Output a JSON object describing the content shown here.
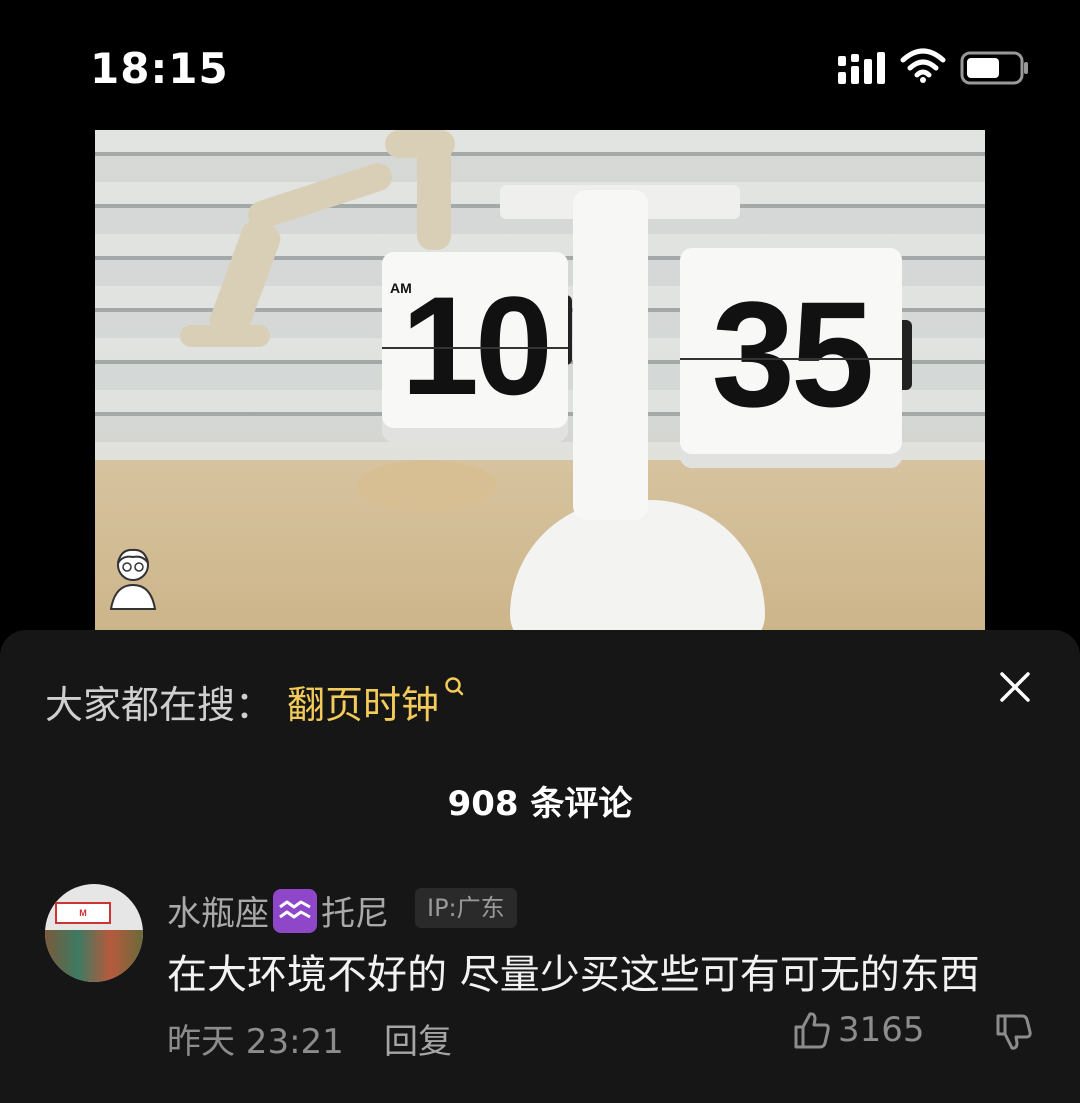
{
  "status_bar": {
    "time": "18:15"
  },
  "video": {
    "clock_ampm": "AM",
    "clock_hours": "10",
    "clock_minutes": "35"
  },
  "panel": {
    "search_prefix": "大家都在搜：",
    "search_term": "翻页时钟",
    "comments_count": "908 条评论"
  },
  "comment": {
    "username_part1": "水瓶座",
    "username_part2": "托尼",
    "ip": "IP:广东",
    "text": "在大环境不好的 尽量少买这些可有可无的东西",
    "time": "昨天 23:21",
    "reply_label": "回复",
    "like_count": "3165",
    "avatar_sign": "M"
  },
  "colors": {
    "accent_search": "#f2cb5a",
    "panel_bg": "#161616",
    "zodiac_badge": "#8e47c9"
  }
}
